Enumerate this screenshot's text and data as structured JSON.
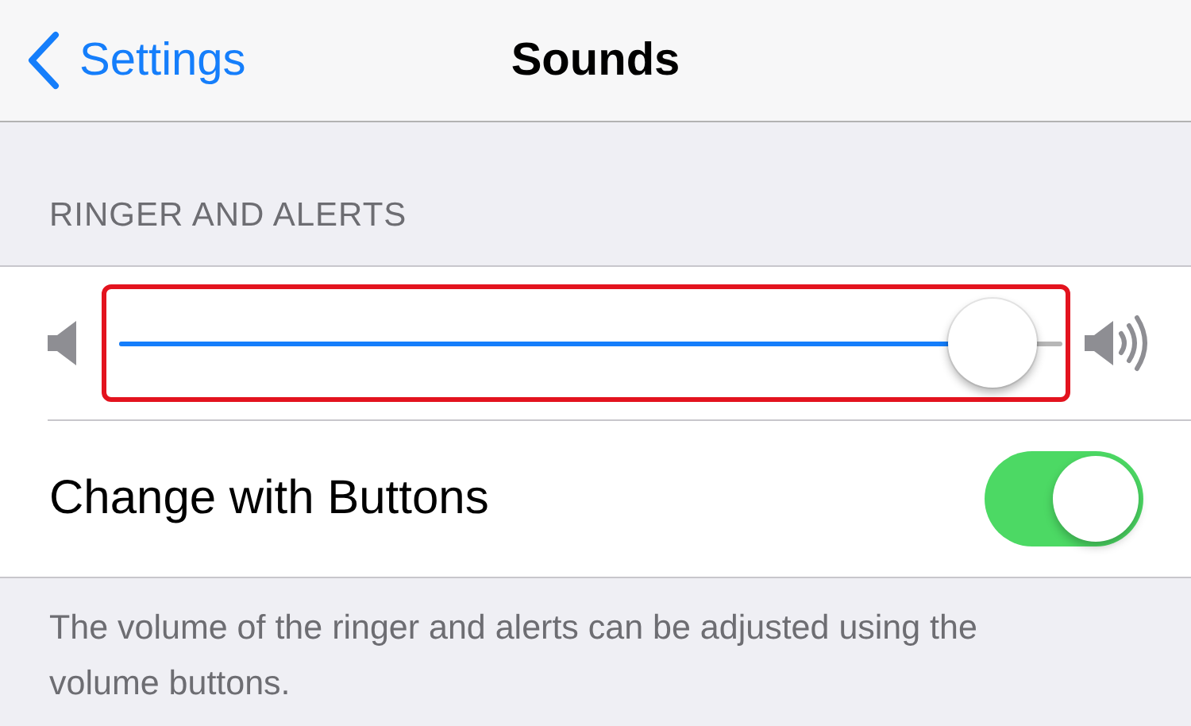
{
  "nav": {
    "back_label": "Settings",
    "title": "Sounds"
  },
  "section": {
    "header": "RINGER AND ALERTS",
    "rows": [
      {
        "kind": "slider",
        "level": 0.97,
        "highlighted": true
      },
      {
        "kind": "toggle",
        "label": "Change with Buttons",
        "on": true
      }
    ],
    "footer": "The volume of the ringer and alerts can be adjusted using the volume buttons."
  }
}
